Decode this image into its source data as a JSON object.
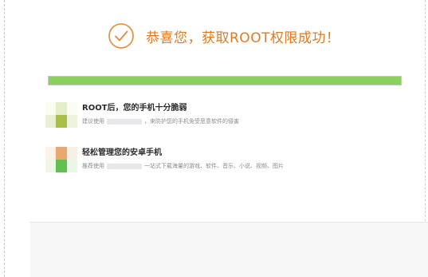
{
  "header": {
    "title": "恭喜您，获取ROOT权限成功！",
    "accent_color": "#e07a1f",
    "icon": "check-circle-icon"
  },
  "progress": {
    "value": 1.0,
    "color": "#8ad15b"
  },
  "features": [
    {
      "title": "ROOT后，您的手机十分脆弱",
      "desc_before": "建议使用",
      "desc_after": "，来防护您的手机免受恶意软件的侵害",
      "icon": "app-logo-icon"
    },
    {
      "title": "轻松管理您的安卓手机",
      "desc_before": "推荐使用",
      "desc_after": "一站式下载海量的游戏、软件、音乐、小说、视频、图片",
      "icon": "app-logo-icon"
    }
  ]
}
